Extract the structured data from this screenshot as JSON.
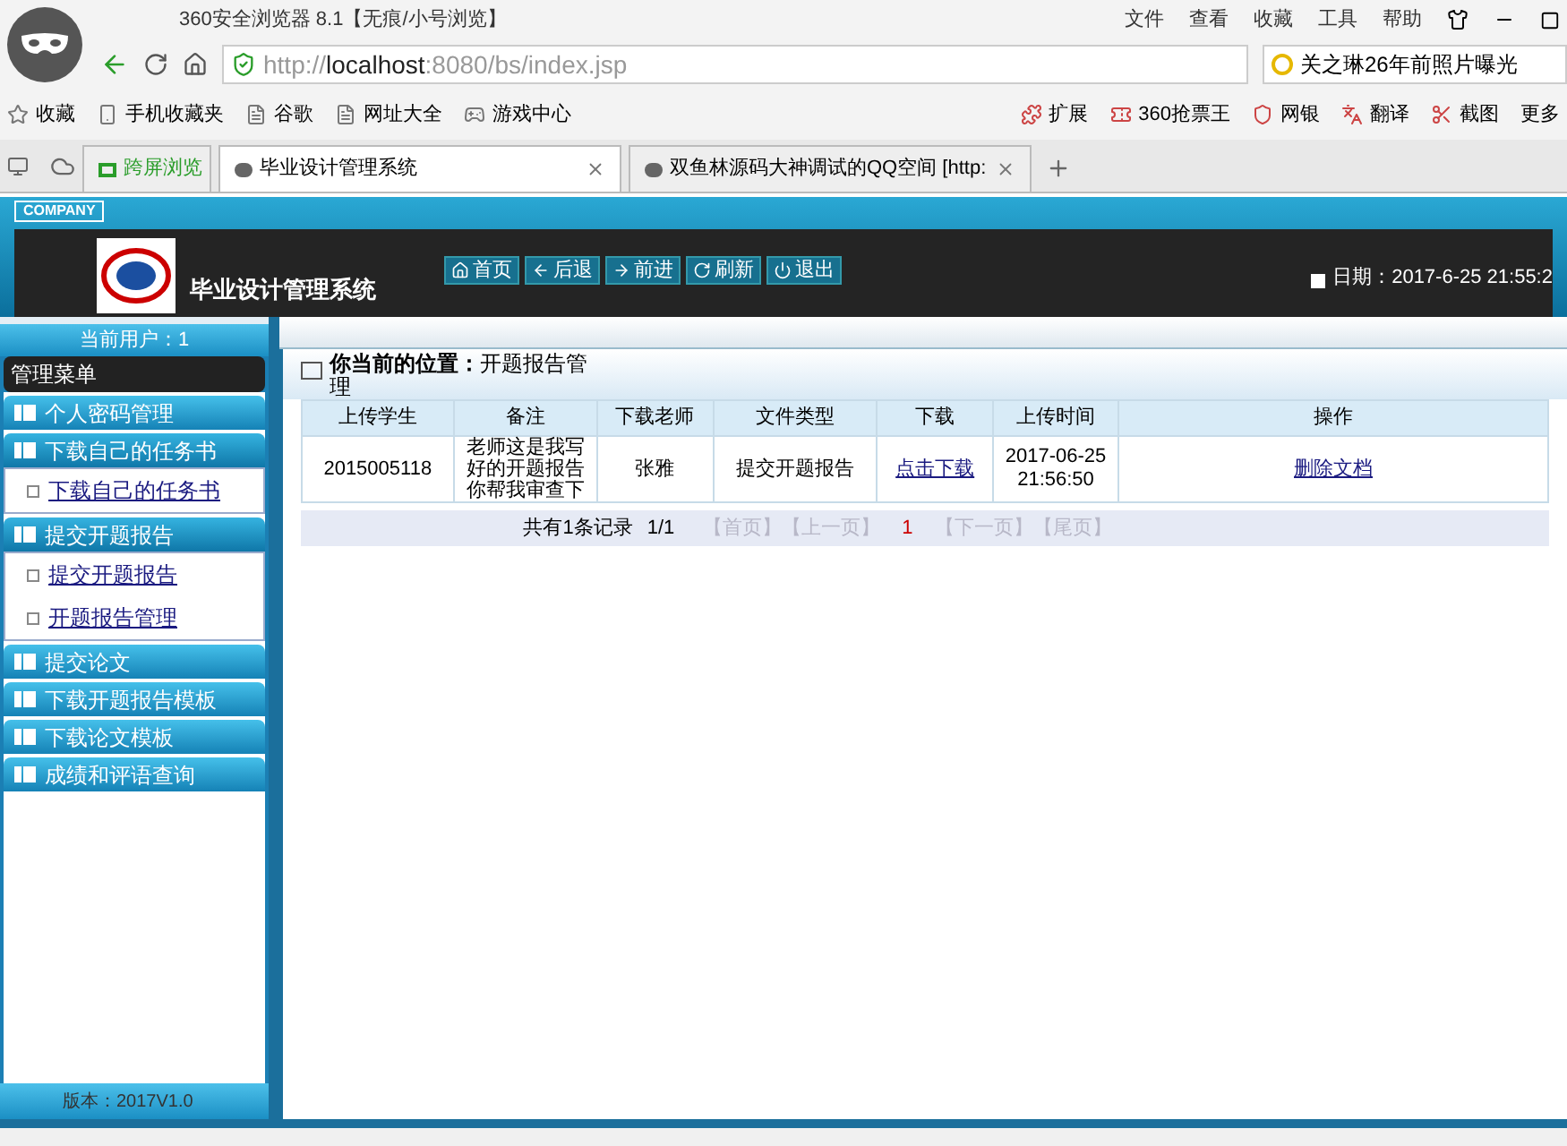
{
  "browser": {
    "title": "360安全浏览器 8.1【无痕/小号浏览】",
    "menu": [
      "文件",
      "查看",
      "收藏",
      "工具",
      "帮助"
    ],
    "url": {
      "scheme": "http://",
      "host": "localhost",
      "rest": ":8080/bs/index.jsp"
    },
    "search": {
      "value": "关之琳26年前照片曝光"
    },
    "bookmarks": [
      "收藏",
      "手机收藏夹",
      "谷歌",
      "网址大全",
      "游戏中心"
    ],
    "tools": [
      "扩展",
      "360抢票王",
      "网银",
      "翻译",
      "截图",
      "更多"
    ],
    "tabs": [
      {
        "label": "跨屏浏览",
        "kind": "special",
        "selected": false
      },
      {
        "label": "毕业设计管理系统",
        "kind": "page",
        "selected": true
      },
      {
        "label": "双鱼林源码大神调试的QQ空间 [http:",
        "kind": "page",
        "selected": false
      }
    ]
  },
  "app": {
    "company": "COMPANY",
    "title": "毕业设计管理系统",
    "nav": [
      {
        "label": "首页"
      },
      {
        "label": "后退"
      },
      {
        "label": "前进"
      },
      {
        "label": "刷新"
      },
      {
        "label": "退出"
      }
    ],
    "date": "日期：2017-6-25 21:55:2"
  },
  "sidebar": {
    "user": "当前用户：1",
    "menu_title": "管理菜单",
    "groups": [
      {
        "label": "个人密码管理",
        "expanded": false
      },
      {
        "label": "下载自己的任务书",
        "expanded": true,
        "children": [
          {
            "label": "下载自己的任务书"
          }
        ]
      },
      {
        "label": "提交开题报告",
        "expanded": true,
        "children": [
          {
            "label": "提交开题报告"
          },
          {
            "label": "开题报告管理"
          }
        ]
      },
      {
        "label": "提交论文",
        "expanded": false
      },
      {
        "label": "下载开题报告模板",
        "expanded": false
      },
      {
        "label": "下载论文模板",
        "expanded": false
      },
      {
        "label": "成绩和评语查询",
        "expanded": false
      }
    ],
    "version": "版本：2017V1.0"
  },
  "content": {
    "location_label": "你当前的位置：",
    "location": "开题报告管理",
    "table": {
      "columns": [
        "上传学生",
        "备注",
        "下载老师",
        "文件类型",
        "下载",
        "上传时间",
        "操作"
      ],
      "rows": [
        {
          "student": "2015005118",
          "note": "老师这是我写好的开题报告你帮我审查下",
          "teacher": "张雅",
          "type": "提交开题报告",
          "download": "点击下载",
          "time": "2017-06-25 21:56:50",
          "action": "删除文档"
        }
      ]
    },
    "pager": {
      "summary": "共有1条记录",
      "pages": "1/1",
      "links": [
        {
          "label": "【首页】",
          "kind": "link",
          "disabled": true
        },
        {
          "label": "【上一页】",
          "kind": "link",
          "disabled": true
        },
        {
          "label": "1",
          "kind": "current",
          "disabled": false
        },
        {
          "label": "【下一页】",
          "kind": "link",
          "disabled": true
        },
        {
          "label": "【尾页】",
          "kind": "link",
          "disabled": true
        }
      ]
    }
  }
}
